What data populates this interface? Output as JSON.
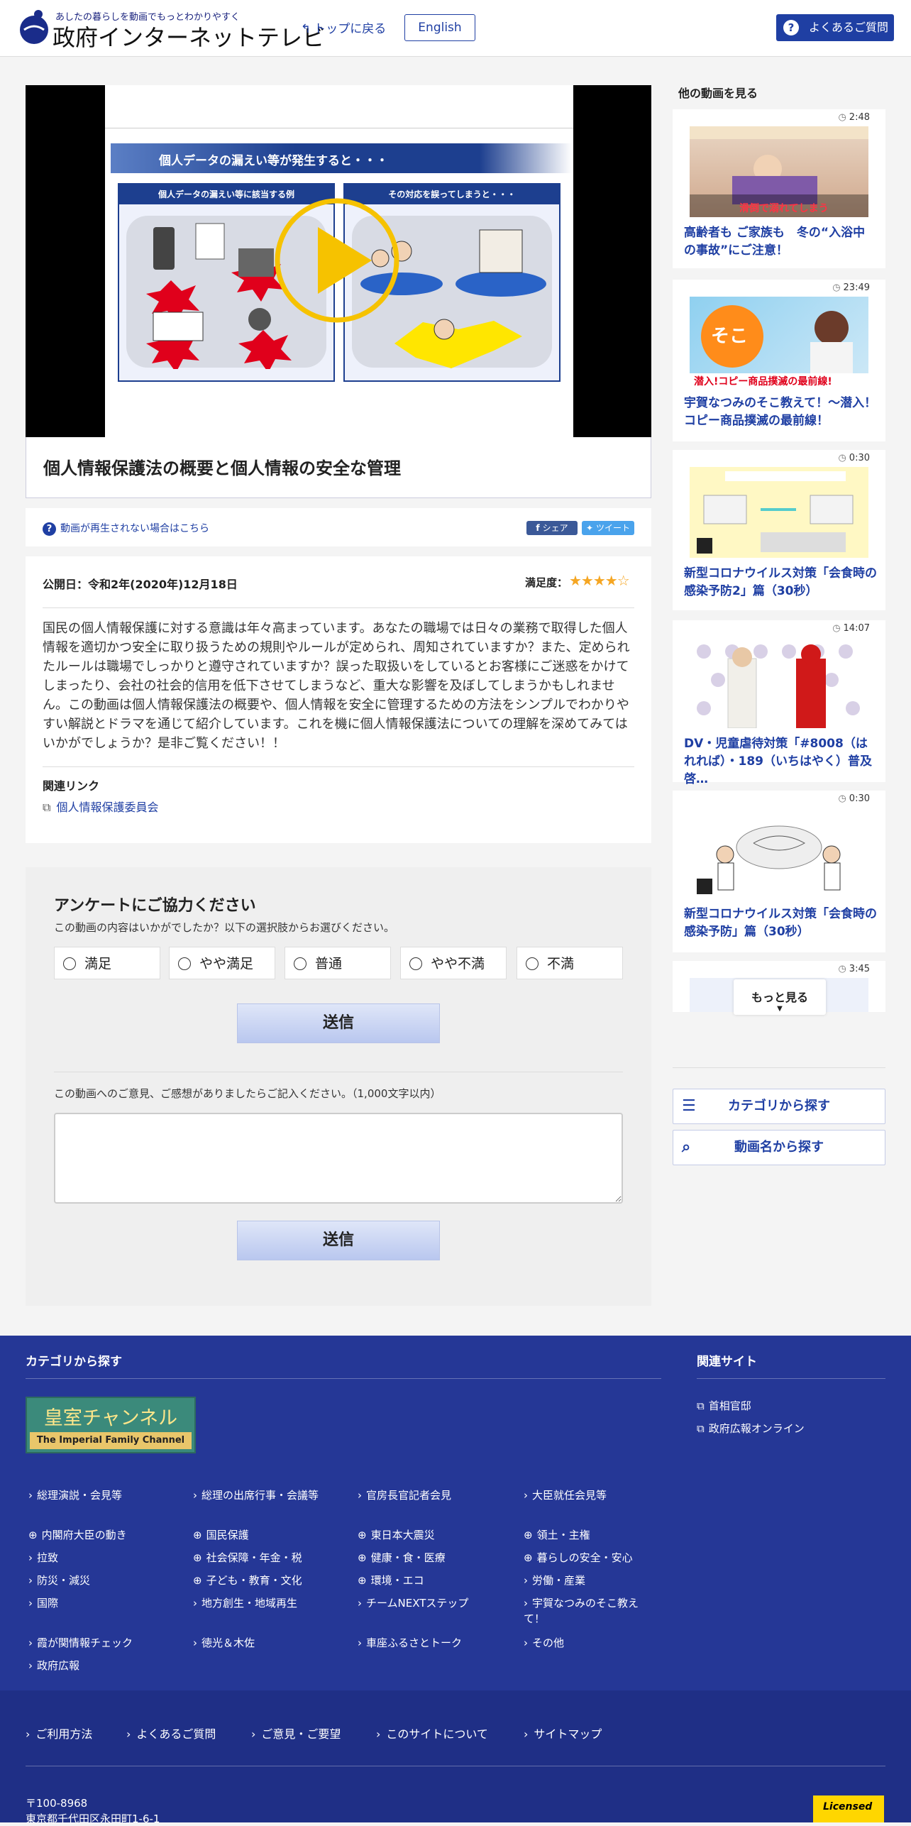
{
  "header": {
    "tagline": "あしたの暮らしを動画でもっとわかりやすく",
    "site_name": "政府インターネットテレビ",
    "back_top": "トップに戻る",
    "english": "English",
    "faq": "よくあるご質問"
  },
  "video": {
    "slide_title": "個人データの漏えい等が発生すると・・・",
    "slide_left_caption": "個人データの漏えい等に該当する例",
    "slide_right_caption": "その対応を誤ってしまうと・・・",
    "title": "個人情報保護法の概要と個人情報の安全な管理",
    "cant_play": "動画が再生されない場合はこちら",
    "share": "シェア",
    "tweet": "ツイート"
  },
  "info": {
    "published": "公開日：令和2年(2020年)12月18日",
    "satisfaction_label": "満足度：",
    "stars": "★★★★☆",
    "rating": 4,
    "rating_max": 5,
    "description": "国民の個人情報保護に対する意識は年々高まっています。あなたの職場では日々の業務で取得した個人情報を適切かつ安全に取り扱うための規則やルールが定められ、周知されていますか？また、定められたルールは職場でしっかりと遵守されていますか？誤った取扱いをしているとお客様にご迷惑をかけてしまったり、会社の社会的信用を低下させてしまうなど、重大な影響を及ぼしてしまうかもしれません。この動画は個人情報保護法の概要や、個人情報を安全に管理するための方法をシンプルでわかりやすい解説とドラマを通じて紹介しています。これを機に個人情報保護法についての理解を深めてみてはいかがでしょうか？是非ご覧ください！！",
    "related_heading": "関連リンク",
    "related_link": "個人情報保護委員会"
  },
  "survey": {
    "title": "アンケートにご協力ください",
    "subtitle": "この動画の内容はいかがでしたか？以下の選択肢からお選びください。",
    "options": [
      "満足",
      "やや満足",
      "普通",
      "やや不満",
      "不満"
    ],
    "send": "送信",
    "comment_prompt": "この動画へのご意見、ご感想がありましたらご記入ください。（1,000文字以内）",
    "comment_value": ""
  },
  "sidebar": {
    "title": "他の動画を見る",
    "videos": [
      {
        "duration": "2:48",
        "title": "高齢者も ご家族も　冬の“入浴中の事故”にご注意！"
      },
      {
        "duration": "23:49",
        "title": "宇賀なつみのそこ教えて！～潜入！コピー商品撲滅の最前線！"
      },
      {
        "duration": "0:30",
        "title": "新型コロナウイルス対策「会食時の感染予防2」篇（30秒）"
      },
      {
        "duration": "14:07",
        "title": "DV・児童虐待対策「#8008（はれれば）・189（いちはやく）普及啓…"
      },
      {
        "duration": "0:30",
        "title": "新型コロナウイルス対策「会食時の感染予防」篇（30秒）"
      },
      {
        "duration": "3:45",
        "title": ""
      }
    ],
    "more": "もっと見る",
    "category_btn": "カテゴリから探す",
    "name_btn": "動画名から探す"
  },
  "footer": {
    "cat_title": "カテゴリから探す",
    "site_title": "関連サイト",
    "imperial_jp": "皇室チャンネル",
    "imperial_en": "The Imperial Family Channel",
    "categories": [
      "総理演説・会見等",
      "総理の出席行事・会議等",
      "官房長官記者会見",
      "大臣就任会見等",
      "内閣府大臣の動き",
      "国民保護",
      "東日本大震災",
      "領土・主権",
      "拉致",
      "社会保障・年金・税",
      "健康・食・医療",
      "暮らしの安全・安心",
      "防災・減災",
      "子ども・教育・文化",
      "環境・エコ",
      "労働・産業",
      "国際",
      "地方創生・地域再生",
      "チームNEXTステップ",
      "宇賀なつみのそこ教えて！",
      "霞が関情報チェック",
      "徳光＆木佐",
      "車座ふるさとトーク",
      "その他",
      "政府広報"
    ],
    "sites": [
      "首相官邸",
      "政府広報オンライン"
    ],
    "bottom_links": [
      "ご利用方法",
      "よくあるご質問",
      "ご意見・ご要望",
      "このサイトについて",
      "サイトマップ"
    ],
    "postal": "〒100-8968",
    "address": "東京都千代田区永田町1-6-1",
    "licensed": "Licensed"
  },
  "colors": {
    "brand": "#1f3fa3",
    "footer": "#253796",
    "star": "#f5a623"
  }
}
